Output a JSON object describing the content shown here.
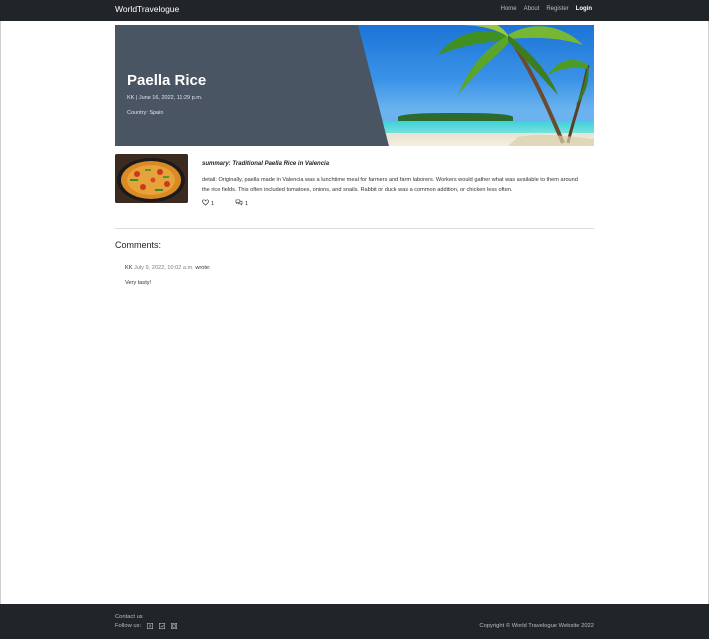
{
  "navbar": {
    "brand": "WorldTravelogue",
    "links": [
      "Home",
      "About",
      "Register",
      "Login"
    ]
  },
  "hero": {
    "title": "Paella Rice",
    "meta": "KK | June 16, 2022, 11:29 p.m.",
    "country": "Country: Spain"
  },
  "post": {
    "summary": "summary: Traditional Paella Rice in Valencia",
    "detail": "detail: Originally, paella made in Valencia was a lunchtime meal for farmers and farm laborers. Workers would gather what was available to them around the rice fields. This often included tomatoes, onions, and snails. Rabbit or duck was a common addition, or chicken less often.",
    "likes": "1",
    "comments": "1"
  },
  "comments": {
    "heading": "Comments:",
    "items": [
      {
        "author": "KK",
        "date": "July 9, 2022, 10:02 a.m.",
        "suffix": "wrote:",
        "body": "Very tasty!"
      }
    ]
  },
  "footer": {
    "contact": "Contact us",
    "follow": "Follow us:",
    "social_icons": [
      "facebook-icon",
      "twitter-icon",
      "youtube-icon"
    ],
    "copyright": "Copyright © World Travelogue Website 2022"
  },
  "colors": {
    "navbar_bg": "#212529",
    "hero_bg": "#4a5564",
    "footer_bg": "#212529"
  }
}
